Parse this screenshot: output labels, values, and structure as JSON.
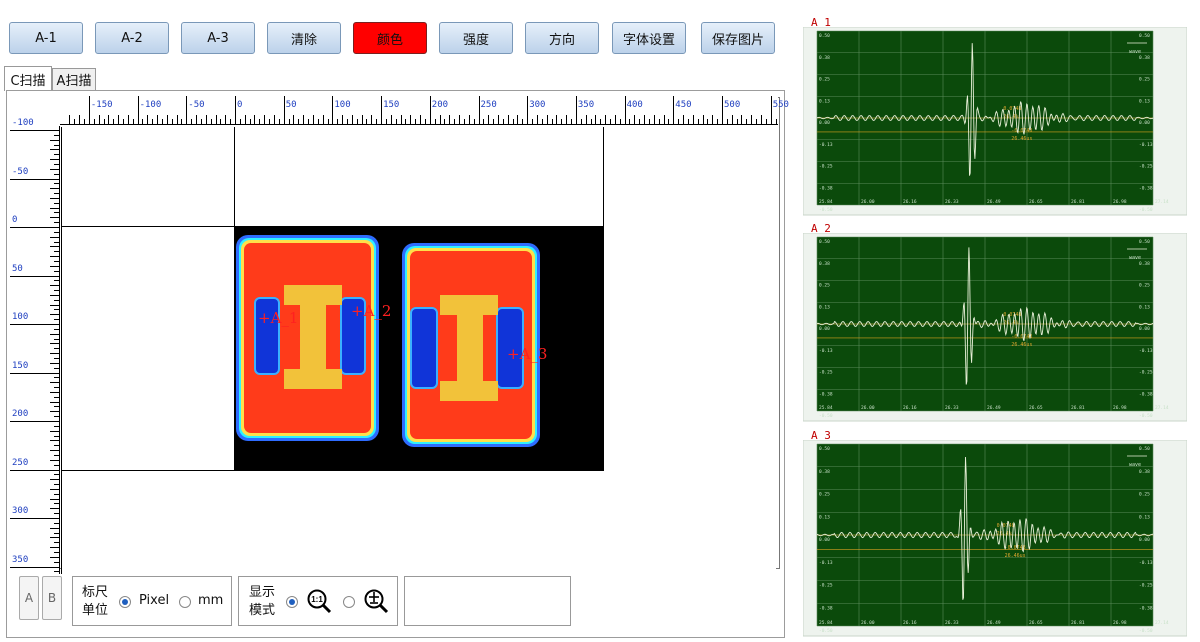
{
  "toolbar": {
    "a1": "A-1",
    "a2": "A-2",
    "a3": "A-3",
    "clear": "清除",
    "color": "颜色",
    "intensity": "强度",
    "direction": "方向",
    "font": "字体设置",
    "save": "保存图片"
  },
  "tabs": {
    "cscan": "C扫描",
    "ascan": "A扫描"
  },
  "ruler": {
    "top": [
      "-150",
      "-100",
      "-50",
      "0",
      "50",
      "100",
      "150",
      "200",
      "250",
      "300",
      "350",
      "400",
      "450",
      "500",
      "550"
    ],
    "left": [
      "-100",
      "-50",
      "0",
      "50",
      "100",
      "150",
      "200",
      "250",
      "300",
      "350"
    ]
  },
  "markers": {
    "m1": "+A_1",
    "m2": "+A_2",
    "m3": "+A_3"
  },
  "bottom": {
    "btn_a": "A",
    "btn_b": "B",
    "ruler_unit_label_1": "标尺",
    "ruler_unit_label_2": "单位",
    "pixel": "Pixel",
    "mm": "mm",
    "display_mode_1": "显示",
    "display_mode_2": "模式",
    "zoom_one": "1:1"
  },
  "waves": [
    {
      "title": "A_1",
      "legend": "wave",
      "yticks": [
        "0.50",
        "0.38",
        "0.25",
        "0.13",
        "0.00",
        "-0.13",
        "-0.25",
        "-0.38",
        "-0.50"
      ],
      "xticks": [
        "25.84",
        "26.00",
        "26.16",
        "26.33",
        "26.49",
        "26.65",
        "26.81",
        "26.98",
        "27.14"
      ],
      "readout": [
        "0.0748",
        "26.4%",
        "-0.0748",
        "26.46us"
      ]
    },
    {
      "title": "A_2",
      "legend": "wave",
      "yticks": [
        "0.50",
        "0.38",
        "0.25",
        "0.13",
        "0.00",
        "-0.13",
        "-0.25",
        "-0.38",
        "-0.50"
      ],
      "xticks": [
        "25.84",
        "26.00",
        "26.16",
        "26.33",
        "26.49",
        "26.65",
        "26.81",
        "26.98",
        "27.14"
      ],
      "readout": [
        "0.0748",
        "26.4%",
        "-0.0748",
        "26.46us"
      ]
    },
    {
      "title": "A_3",
      "legend": "wave",
      "yticks": [
        "0.50",
        "0.38",
        "0.25",
        "0.13",
        "0.00",
        "-0.13",
        "-0.25",
        "-0.38",
        "-0.50"
      ],
      "xticks": [
        "25.84",
        "26.00",
        "26.16",
        "26.33",
        "26.49",
        "26.65",
        "26.81",
        "26.98",
        "27.14"
      ],
      "readout": [
        "0.0748",
        "26.4%",
        "-0.0748",
        "26.46us"
      ]
    }
  ],
  "colors": {
    "plot_bg": "#0b4a0b",
    "grid": "#5a8a5a",
    "trace": "#e8f0d8",
    "accent": "#ff0000"
  }
}
